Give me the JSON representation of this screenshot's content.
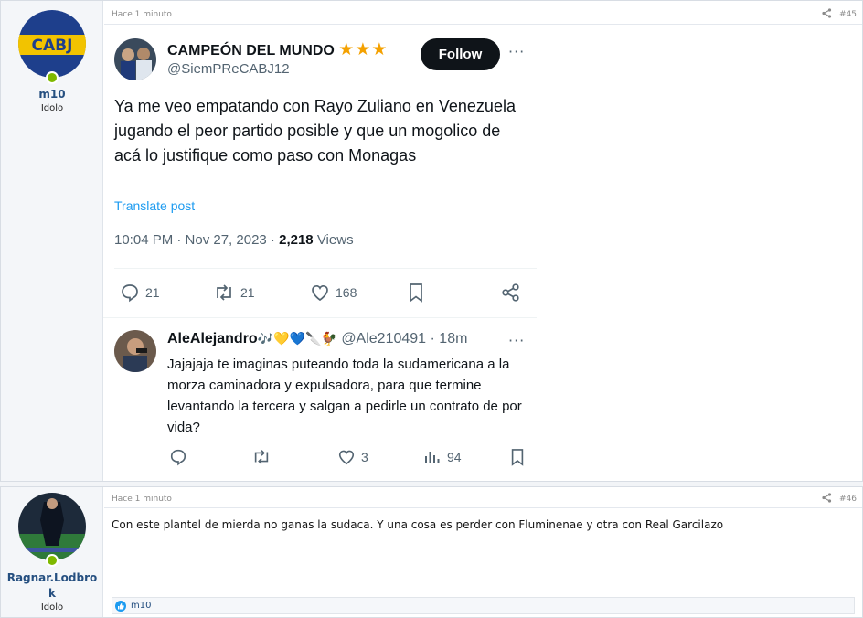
{
  "posts": [
    {
      "author": "m10",
      "user_title": "Idolo",
      "time": "Hace 1 minuto",
      "number": "#45",
      "avatar_text": "CABJ"
    },
    {
      "author_line1": "Ragnar.Lodbro",
      "author_line2": "k",
      "user_title": "Idolo",
      "time": "Hace 1 minuto",
      "number": "#46",
      "message": "Con este plantel de mierda no ganas la sudaca. Y una cosa es perder con Fluminenae y otra con Real Garcilazo",
      "reaction_user": "m10"
    }
  ],
  "tweet": {
    "display_name": "CAMPEÓN DEL MUNDO",
    "stars": "★★★",
    "handle": "@SiemPReCABJ12",
    "follow_label": "Follow",
    "more": "···",
    "text": "Ya me veo empatando con Rayo Zuliano en Venezuela jugando el peor partido posible y que un mogolico de acá lo justifique como paso con Monagas",
    "translate": "Translate post",
    "date": "10:04 PM · Nov 27, 2023 · ",
    "views_count": "2,218",
    "views_label": " Views",
    "replies": "21",
    "retweets": "21",
    "likes": "168"
  },
  "reply": {
    "display_name": "AleAlejandro",
    "emojis": "🎶💛💙🔪🐓",
    "handle_time": "@Ale210491 · 18m",
    "more": "···",
    "text": "Jajajaja te imaginas puteando toda la sudamericana a la morza caminadora y expulsadora, para que termine levantando la tercera y salgan a pedirle un contrato de por vida?",
    "likes": "3",
    "views": "94"
  },
  "colors": {
    "accent": "#1d9bf0",
    "username": "#254f80",
    "online": "#7fb900"
  }
}
